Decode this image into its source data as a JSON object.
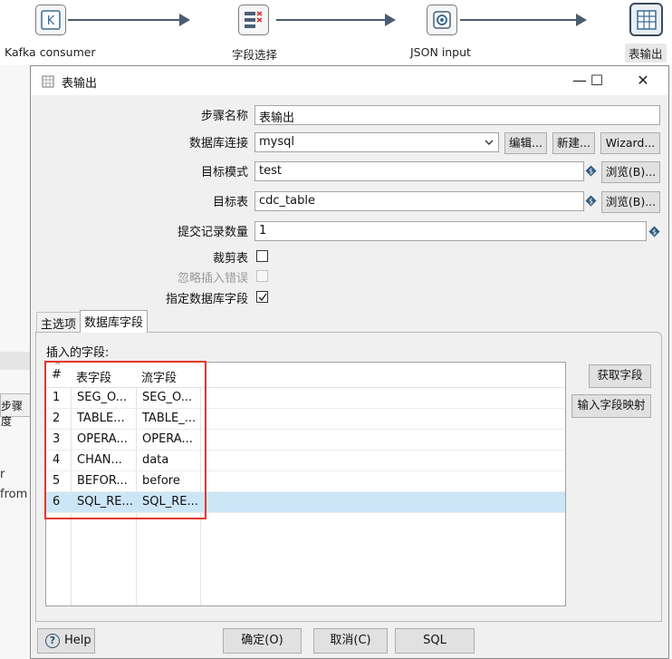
{
  "flow": {
    "nodes": [
      {
        "label": "Kafka consumer",
        "icon": "kafka-icon"
      },
      {
        "label": "字段选择",
        "icon": "select-values-icon"
      },
      {
        "label": "JSON input",
        "icon": "json-input-icon"
      },
      {
        "label": "表输出",
        "icon": "table-output-icon"
      }
    ]
  },
  "background": {
    "button_label": "步骤度",
    "text_line1": "r",
    "text_line2": "from"
  },
  "dialog": {
    "title": "表输出",
    "window_controls": {
      "minimize": "—",
      "maximize": "☐",
      "close": "✕"
    },
    "fields": {
      "step_name_label": "步骤名称",
      "step_name_value": "表输出",
      "db_conn_label": "数据库连接",
      "db_conn_value": "mysql",
      "edit_button": "编辑...",
      "new_button": "新建...",
      "wizard_button": "Wizard...",
      "target_schema_label": "目标模式",
      "target_schema_value": "test",
      "browse_button_1": "浏览(B)...",
      "target_table_label": "目标表",
      "target_table_value": "cdc_table",
      "browse_button_2": "浏览(B)...",
      "commit_size_label": "提交记录数量",
      "commit_size_value": "1",
      "truncate_label": "裁剪表",
      "truncate_checked": false,
      "ignore_errors_label": "忽略插入错误",
      "ignore_errors_checked": false,
      "specify_fields_label": "指定数据库字段",
      "specify_fields_checked": true
    },
    "tabs": [
      {
        "label": "主选项",
        "active": false
      },
      {
        "label": "数据库字段",
        "active": true
      }
    ],
    "fields_tab": {
      "section_label": "插入的字段:",
      "get_fields_button": "获取字段",
      "mapping_button": "输入字段映射",
      "columns": [
        "#",
        "表字段",
        "流字段"
      ],
      "rows": [
        {
          "num": "1",
          "table_field": "SEG_O...",
          "stream_field": "SEG_O..."
        },
        {
          "num": "2",
          "table_field": "TABLE...",
          "stream_field": "TABLE_..."
        },
        {
          "num": "3",
          "table_field": "OPERA...",
          "stream_field": "OPERA..."
        },
        {
          "num": "4",
          "table_field": "CHAN...",
          "stream_field": "data"
        },
        {
          "num": "5",
          "table_field": "BEFOR...",
          "stream_field": "before"
        },
        {
          "num": "6",
          "table_field": "SQL_RE...",
          "stream_field": "SQL_RE..."
        }
      ],
      "selected_row": 6
    },
    "buttons": {
      "help": "Help",
      "ok": "确定(O)",
      "cancel": "取消(C)",
      "sql": "SQL"
    }
  },
  "colors": {
    "highlight": "#e0392d",
    "selected_row": "#cde6f7",
    "dialog_bg": "#f0f0f0"
  }
}
